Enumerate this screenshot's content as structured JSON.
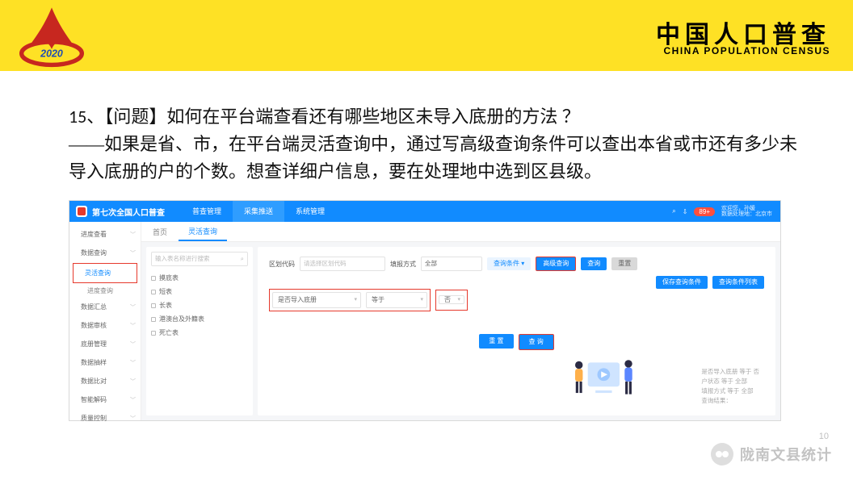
{
  "brand": {
    "cn": "中国人口普查",
    "en": "CHINA POPULATION CENSUS",
    "year": "2020"
  },
  "question": {
    "number": "15、",
    "tag": "【问题】",
    "title": "如何在平台端查看还有哪些地区未导入底册的方法 ？",
    "answer": "——如果是省、市，在平台端灵活查询中，通过写高级查询条件可以查出本省或市还有多少未导入底册的户的个数。想查详细户信息，要在处理地中选到区县级。"
  },
  "app": {
    "title": "第七次全国人口普查",
    "tabs": [
      "普查管理",
      "采集推送",
      "系统管理"
    ],
    "active_tab_index": 1,
    "user": {
      "badge": "89+",
      "line1": "欢迎您，孙媛",
      "line2": "数据处理地：北京市"
    }
  },
  "nav": {
    "items": [
      {
        "label": "进度查看",
        "chev": true
      },
      {
        "label": "数据查询",
        "chev": true
      },
      {
        "label": "灵活查询",
        "current": true
      },
      {
        "label": "进度查询"
      },
      {
        "label": "数据汇总",
        "chev": true
      },
      {
        "label": "数据审核",
        "chev": true
      },
      {
        "label": "底册管理",
        "chev": true
      },
      {
        "label": "数据抽样",
        "chev": true
      },
      {
        "label": "数据比对",
        "chev": true
      },
      {
        "label": "智能解码",
        "chev": true
      },
      {
        "label": "质量控制",
        "chev": true
      }
    ]
  },
  "crumb": {
    "home": "首页",
    "current": "灵活查询"
  },
  "tree": {
    "search_placeholder": "输入表名称进行搜索",
    "items": [
      "摸底表",
      "短表",
      "长表",
      "港澳台及外籍表",
      "死亡表"
    ]
  },
  "form": {
    "lbl_code": "区划代码",
    "ph_code": "请选择区划代码",
    "lbl_mode": "填报方式",
    "val_mode": "全部",
    "btn_cond": "查询条件",
    "btn_advanced": "高级查询",
    "btn_search": "查询",
    "btn_reset": "重置",
    "btn_save_cond": "保存查询条件",
    "btn_cond_list": "查询条件列表",
    "sel_field": "是否导入底册",
    "sel_op": "等于",
    "sel_val": "否",
    "btn_reset2": "重 置",
    "btn_search2": "查 询"
  },
  "summary": {
    "l1": "是否导入底册 等于 否",
    "l2": "户状态 等于 全部",
    "l3": "填报方式 等于 全部",
    "l4": "查询结果："
  },
  "page_number": "10",
  "watermark": "陇南文县统计"
}
